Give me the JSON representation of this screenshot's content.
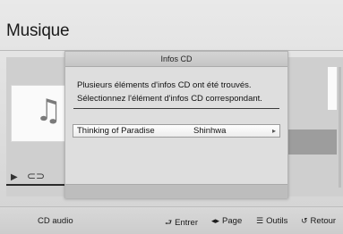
{
  "app": {
    "title": "Musique"
  },
  "player": {
    "album_art_icon": "music-note-icon",
    "play_icon": "play-icon",
    "disc_icon": "cd-icon"
  },
  "dialog": {
    "title": "Infos CD",
    "message_line1": "Plusieurs éléments d'infos CD ont été trouvés.",
    "message_line2": "Sélectionnez l'élément d'infos CD correspondant.",
    "results": [
      {
        "title": "Thinking of Paradise",
        "artist": "Shinhwa"
      }
    ]
  },
  "footer": {
    "source_label": "CD audio",
    "enter_label": "Entrer",
    "page_label": "Page",
    "tools_label": "Outils",
    "back_label": "Retour"
  }
}
